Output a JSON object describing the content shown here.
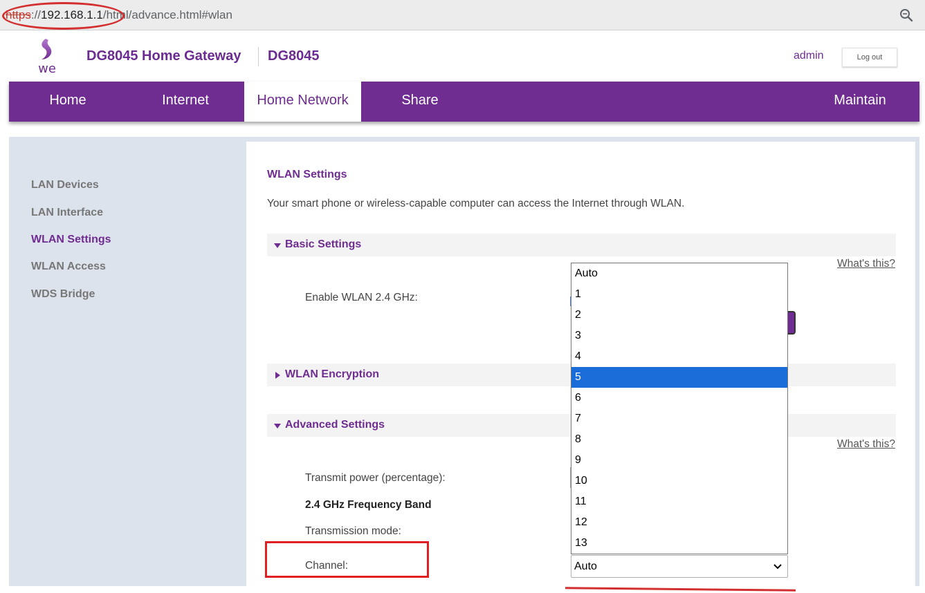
{
  "browser": {
    "url_scheme": "https",
    "url_sep": "://",
    "url_host": "192.168.1.1",
    "url_path": "/html/advance.html#wlan",
    "zoom_icon": "magnifier-icon"
  },
  "header": {
    "logo_text": "we",
    "title": "DG8045 Home Gateway",
    "model": "DG8045",
    "user": "admin",
    "logout_label": "Log out"
  },
  "nav": {
    "items": [
      {
        "label": "Home"
      },
      {
        "label": "Internet"
      },
      {
        "label": "Home Network",
        "active": true
      },
      {
        "label": "Share"
      },
      {
        "label": "Maintain"
      }
    ]
  },
  "sidebar": {
    "items": [
      {
        "label": "LAN Devices"
      },
      {
        "label": "LAN Interface"
      },
      {
        "label": "WLAN Settings",
        "active": true
      },
      {
        "label": "WLAN Access"
      },
      {
        "label": "WDS Bridge"
      }
    ]
  },
  "main": {
    "title": "WLAN Settings",
    "description": "Your smart phone or wireless-capable computer can access the Internet through WLAN.",
    "sections": {
      "basic": "Basic Settings",
      "encryption": "WLAN Encryption",
      "advanced": "Advanced Settings"
    },
    "whats_this": "What's this?",
    "fields": {
      "enable_wlan": "Enable WLAN 2.4 GHz:",
      "transmit_power": "Transmit power (percentage):",
      "band_heading": "2.4 GHz Frequency Band",
      "transmission_mode": "Transmission mode:",
      "channel": "Channel:"
    }
  },
  "channel_select": {
    "value": "Auto",
    "highlighted": "5",
    "options": [
      "Auto",
      "1",
      "2",
      "3",
      "4",
      "5",
      "6",
      "7",
      "8",
      "9",
      "10",
      "11",
      "12",
      "13"
    ]
  },
  "colors": {
    "brand": "#6f2c91",
    "highlight": "#1a6cd9",
    "annotation": "#d32f2f"
  }
}
